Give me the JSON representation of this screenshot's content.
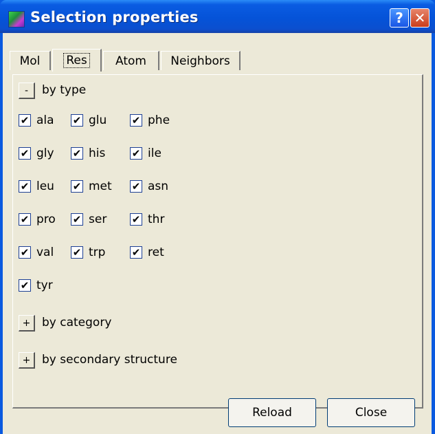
{
  "window": {
    "title": "Selection properties",
    "help_glyph": "?",
    "close_glyph": "✕"
  },
  "tabs": [
    {
      "label": "Mol",
      "active": false
    },
    {
      "label": "Res",
      "active": true
    },
    {
      "label": "Atom",
      "active": false
    },
    {
      "label": "Neighbors",
      "active": false
    }
  ],
  "sections": {
    "by_type": {
      "toggle": "-",
      "label": "by type"
    },
    "by_category": {
      "toggle": "+",
      "label": "by category"
    },
    "by_secondary": {
      "toggle": "+",
      "label": "by secondary structure"
    }
  },
  "residues": [
    {
      "label": "ala",
      "checked": true
    },
    {
      "label": "glu",
      "checked": true
    },
    {
      "label": "phe",
      "checked": true
    },
    {
      "label": "gly",
      "checked": true
    },
    {
      "label": "his",
      "checked": true
    },
    {
      "label": "ile",
      "checked": true
    },
    {
      "label": "leu",
      "checked": true
    },
    {
      "label": "met",
      "checked": true
    },
    {
      "label": "asn",
      "checked": true
    },
    {
      "label": "pro",
      "checked": true
    },
    {
      "label": "ser",
      "checked": true
    },
    {
      "label": "thr",
      "checked": true
    },
    {
      "label": "val",
      "checked": true
    },
    {
      "label": "trp",
      "checked": true
    },
    {
      "label": "ret",
      "checked": true
    },
    {
      "label": "tyr",
      "checked": true
    }
  ],
  "check_glyph": "✔",
  "buttons": {
    "reload": "Reload",
    "close": "Close"
  },
  "colors": {
    "titlebar": "#0553d8",
    "face": "#ece9d8"
  }
}
